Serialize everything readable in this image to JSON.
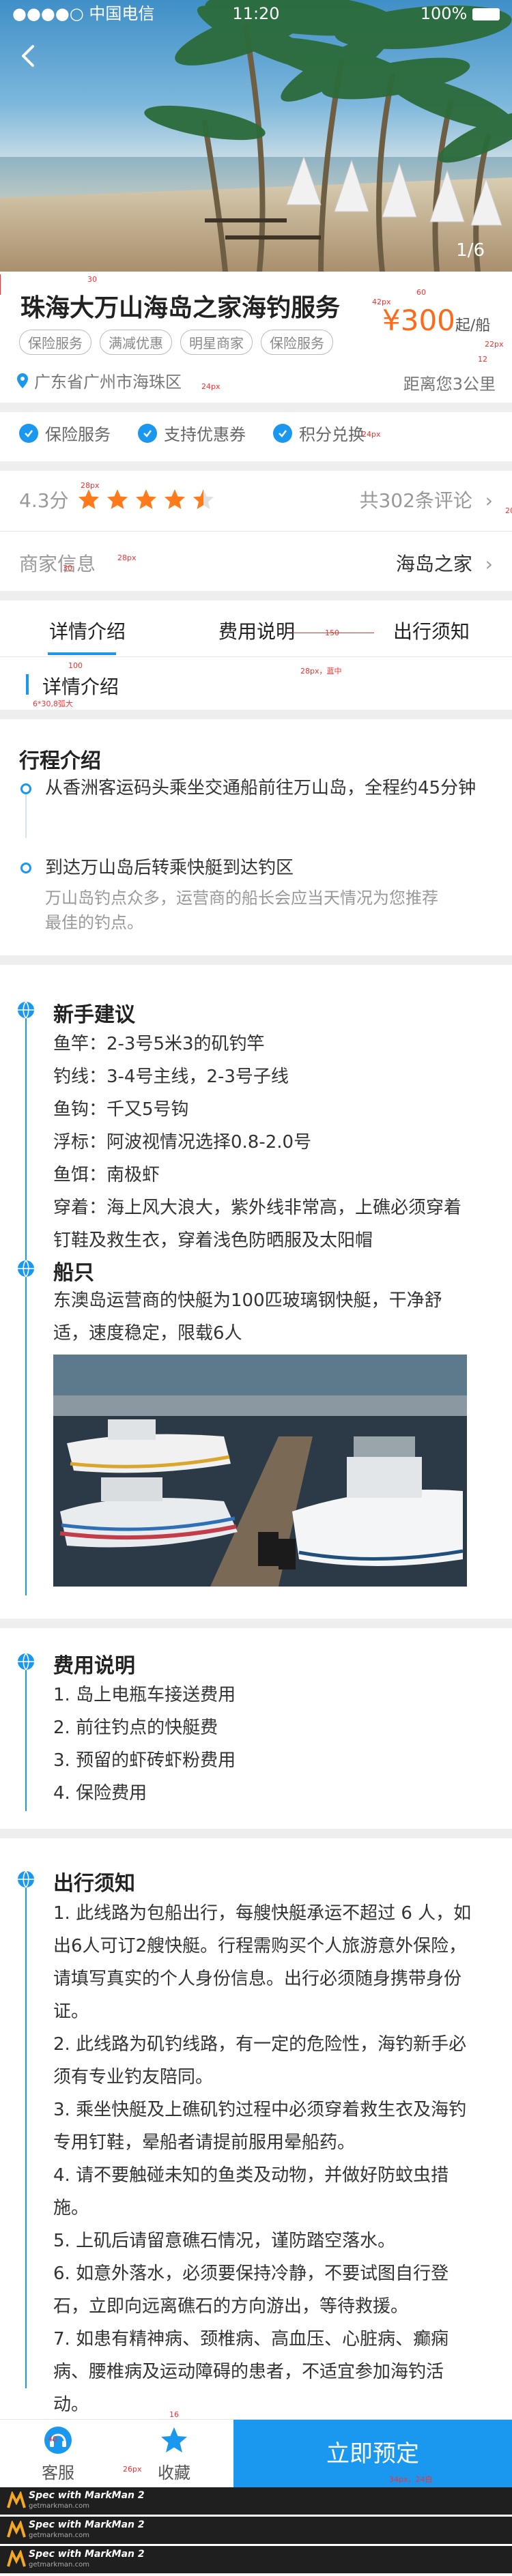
{
  "status_bar": {
    "carrier": "●●●●○ 中国电信",
    "time": "11:20",
    "battery": "100%"
  },
  "hero": {
    "pager": "1/6"
  },
  "title": "珠海大万山海岛之家海钓服务",
  "tags": [
    "保险服务",
    "满减优惠",
    "明星商家",
    "保险服务"
  ],
  "location": "广东省广州市海珠区",
  "price": {
    "amount": "¥300",
    "unit1": "起",
    "unit2": "/船"
  },
  "distance": "距离您3公里",
  "services": [
    "保险服务",
    "支持优惠券",
    "积分兑换"
  ],
  "rating": {
    "score": "4.3分",
    "stars": 4.5,
    "reviews": "共302条评论"
  },
  "merchant": {
    "label": "商家信息",
    "name": "海岛之家"
  },
  "tabs": [
    "详情介绍",
    "费用说明",
    "出行须知"
  ],
  "tab_alt": "详情介绍",
  "itinerary": {
    "title": "行程介绍",
    "steps": [
      {
        "text": "从香洲客运码头乘坐交通船前往万山岛，全程约45分钟"
      },
      {
        "text": "到达万山岛后转乘快艇到达钓区",
        "sub": "万山岛钓点众多，运营商的船长会应当天情况为您推荐最佳的钓点。"
      }
    ]
  },
  "tips": {
    "title": "新手建议",
    "rows": [
      "鱼竿：2-3号5米3的矶钓竿",
      "钓线：3-4号主线，2-3号子线",
      "鱼钩：千又5号钩",
      "浮标：阿波视情况选择0.8-2.0号",
      "鱼饵：南极虾",
      "穿着：海上风大浪大，紫外线非常高，上礁必须穿着钉鞋及救生衣，穿着浅色防晒服及太阳帽"
    ]
  },
  "boat": {
    "title": "船只",
    "text": "东澳岛运营商的快艇为100匹玻璃钢快艇，干净舒适，速度稳定，限载6人"
  },
  "fees": {
    "title": "费用说明",
    "items": [
      "1.   岛上电瓶车接送费用",
      "2.   前往钓点的快艇费",
      "3.   预留的虾砖虾粉费用",
      "4.   保险费用"
    ]
  },
  "notice": {
    "title": "出行须知",
    "items": [
      "1. 此线路为包船出行，每艘快艇承运不超过 6 人，如出6人可订2艘快艇。行程需购买个人旅游意外保险，请填写真实的个人身份信息。出行必须随身携带身份证。",
      "2. 此线路为矶钓线路，有一定的危险性，海钓新手必须有专业钓友陪同。",
      "3. 乘坐快艇及上礁矶钓过程中必须穿着救生衣及海钓专用钉鞋，晕船者请提前服用晕船药。",
      "4. 请不要触碰未知的鱼类及动物，并做好防蚊虫措施。",
      "5. 上矶后请留意礁石情况，谨防踏空落水。",
      "6. 如意外落水，必须要保持冷静，不要试图自行登石，立即向远离礁石的方向游出，等待救援。",
      "7. 如患有精神病、颈椎病、高血压、心脏病、癫痫病、腰椎病及运动障碍的患者，不适宜参加海钓活动。"
    ]
  },
  "bottom_bar": {
    "service": "客服",
    "favorite": "收藏",
    "book": "立即预定"
  },
  "markman": {
    "title": "Spec with MarkMan 2",
    "url": "getmarkman.com"
  },
  "annotations": {
    "a1": "30",
    "a2": "28px",
    "a3": "24px",
    "a4": "42px",
    "a5": "60",
    "a6": "22px",
    "a7": "12",
    "a8": "20",
    "a9": "24px",
    "a10": "30",
    "a11": "28px",
    "a12": "150",
    "a13": "100",
    "a14": "28px，蓝中",
    "a15": "6*30,8弧大",
    "a16": "40",
    "a17": "16",
    "a18": "34px，24白",
    "a19": "26px"
  },
  "colors": {
    "accent": "#1a98f0",
    "price": "#ff6a1a",
    "annotation": "#ff2d2d"
  }
}
